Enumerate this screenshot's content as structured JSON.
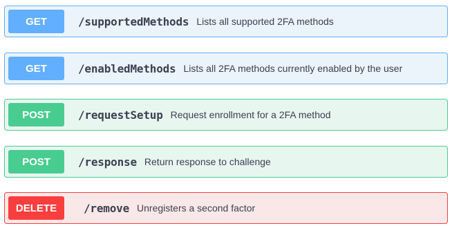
{
  "operations": [
    {
      "method": "GET",
      "path": "/supportedMethods",
      "summary": "Lists all supported 2FA methods",
      "kind": "get"
    },
    {
      "method": "GET",
      "path": "/enabledMethods",
      "summary": "Lists all 2FA methods currently enabled by the user",
      "kind": "get"
    },
    {
      "method": "POST",
      "path": "/requestSetup",
      "summary": "Request enrollment for a 2FA method",
      "kind": "post"
    },
    {
      "method": "POST",
      "path": "/response",
      "summary": "Return response to challenge",
      "kind": "post"
    },
    {
      "method": "DELETE",
      "path": "/remove",
      "summary": "Unregisters a second factor",
      "kind": "delete"
    }
  ],
  "colors": {
    "get": "#61affe",
    "post": "#49cc90",
    "delete": "#f93e3e",
    "text": "#3b4151"
  }
}
